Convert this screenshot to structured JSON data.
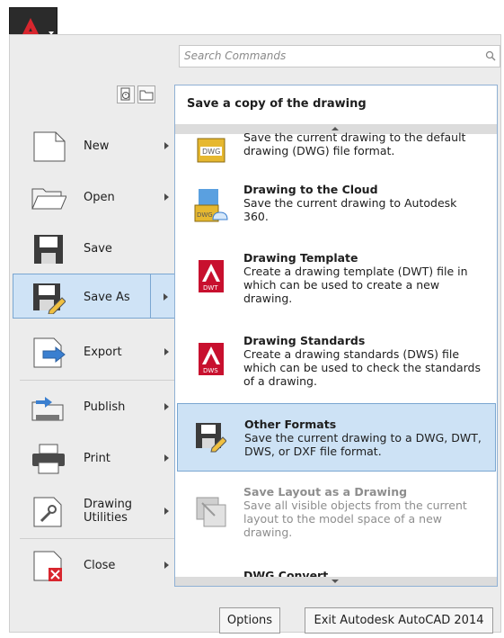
{
  "search": {
    "placeholder": "Search Commands"
  },
  "left_menu": {
    "items": [
      {
        "label": "New"
      },
      {
        "label": "Open"
      },
      {
        "label": "Save"
      },
      {
        "label": "Save As"
      },
      {
        "label": "Export"
      },
      {
        "label": "Publish"
      },
      {
        "label": "Print"
      },
      {
        "label": "Drawing Utilities"
      },
      {
        "label": "Close"
      }
    ]
  },
  "flyout": {
    "header": "Save a copy of the drawing",
    "items": [
      {
        "title": "",
        "desc": "Save the current drawing to the default drawing (DWG) file format.",
        "badge": "DWG"
      },
      {
        "title": "Drawing to the Cloud",
        "desc": "Save the current drawing to Autodesk 360.",
        "badge": "DWG"
      },
      {
        "title": "Drawing Template",
        "desc": "Create a drawing template (DWT) file in which can be used to create a new drawing.",
        "badge": "DWT"
      },
      {
        "title": "Drawing Standards",
        "desc": "Create a drawing standards (DWS) file which can be used to check the standards of a drawing.",
        "badge": "DWS"
      },
      {
        "title": "Other Formats",
        "desc": "Save the current drawing to a DWG, DWT, DWS, or DXF file format."
      },
      {
        "title": "Save Layout as a Drawing",
        "desc": "Save all visible objects from the current layout to the model space of a new drawing."
      },
      {
        "title": "DWG Convert",
        "desc": ""
      }
    ]
  },
  "buttons": {
    "options": "Options",
    "exit": "Exit Autodesk AutoCAD 2014"
  },
  "colors": {
    "accent": "#cfe3f6",
    "brand_red": "#c8102e"
  }
}
